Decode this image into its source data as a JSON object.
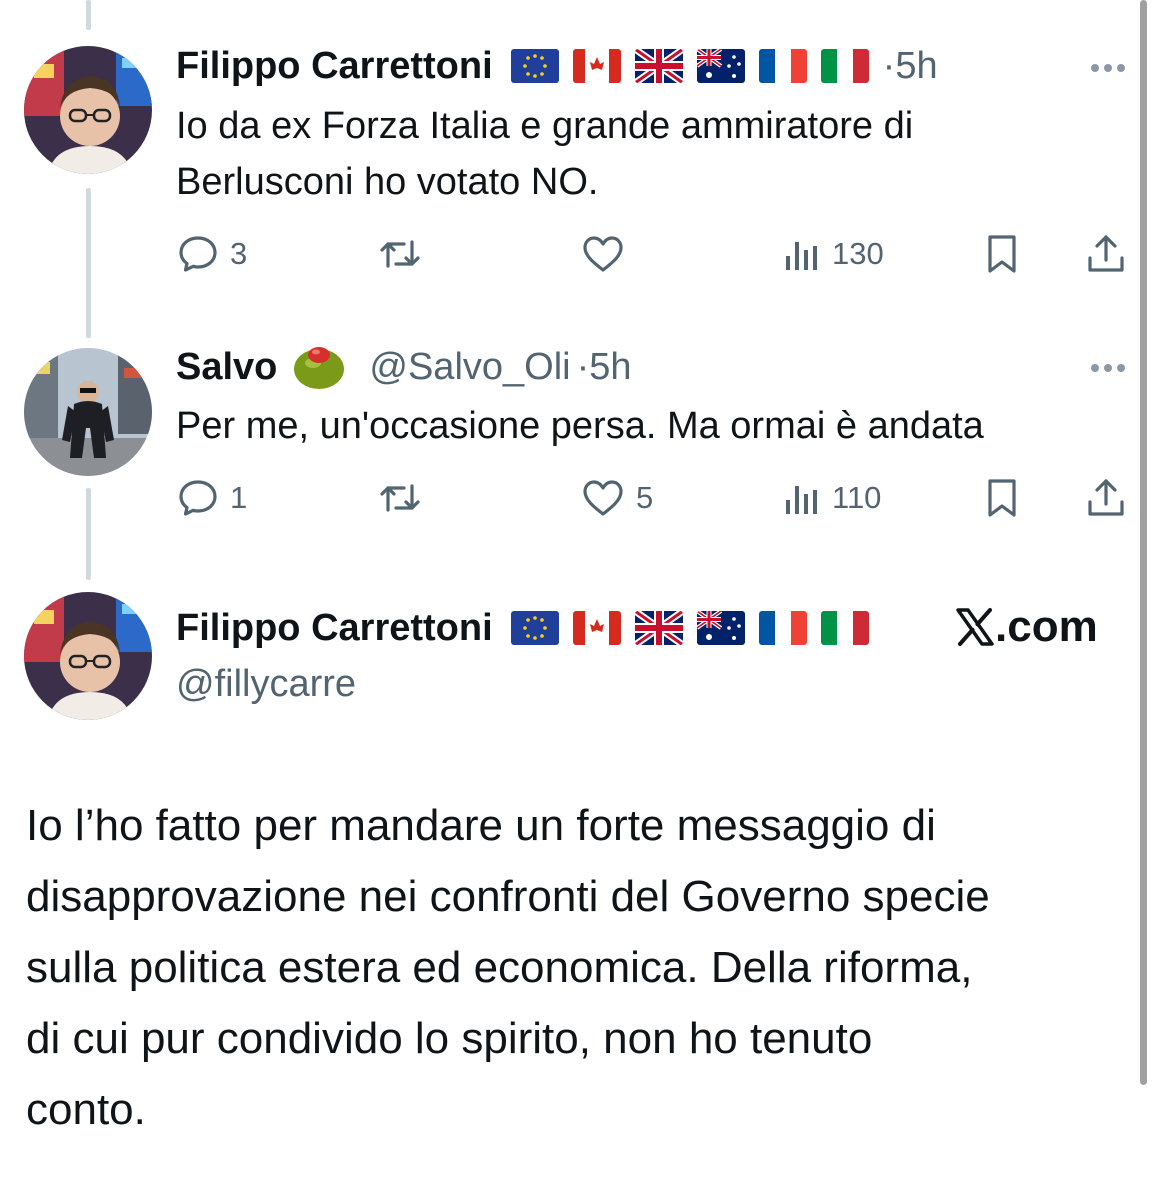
{
  "posts": [
    {
      "name": "Filippo Carrettoni",
      "time": "5h",
      "text_lines": [
        "Io da ex Forza Italia e grande ammiratore di",
        "Berlusconi ho votato NO."
      ],
      "replies": "3",
      "likes": "",
      "views": "130",
      "flags": [
        "eu-flag",
        "canada-flag",
        "uk-flag",
        "australia-flag",
        "france-flag",
        "italy-flag"
      ]
    },
    {
      "name": "Salvo",
      "handle": "@Salvo_Oli",
      "time": "5h",
      "emoji": "olive-emoji",
      "text": "Per me, un'occasione persa. Ma ormai è andata",
      "replies": "1",
      "likes": "5",
      "views": "110"
    }
  ],
  "quoted_post": {
    "name": "Filippo Carrettoni",
    "handle": "@fillycarre",
    "brand": ".com",
    "text_lines": [
      "Io l’ho fatto per mandare un forte messaggio di",
      "disapprovazione nei confronti del Governo specie",
      "sulla politica estera ed economica. Della riforma,",
      "di cui pur condivido lo spirito, non ho tenuto",
      "conto."
    ]
  },
  "separator": "·",
  "colors": {
    "text": "#0f1419",
    "secondary": "#536471",
    "thread_line": "#cfd9de"
  }
}
